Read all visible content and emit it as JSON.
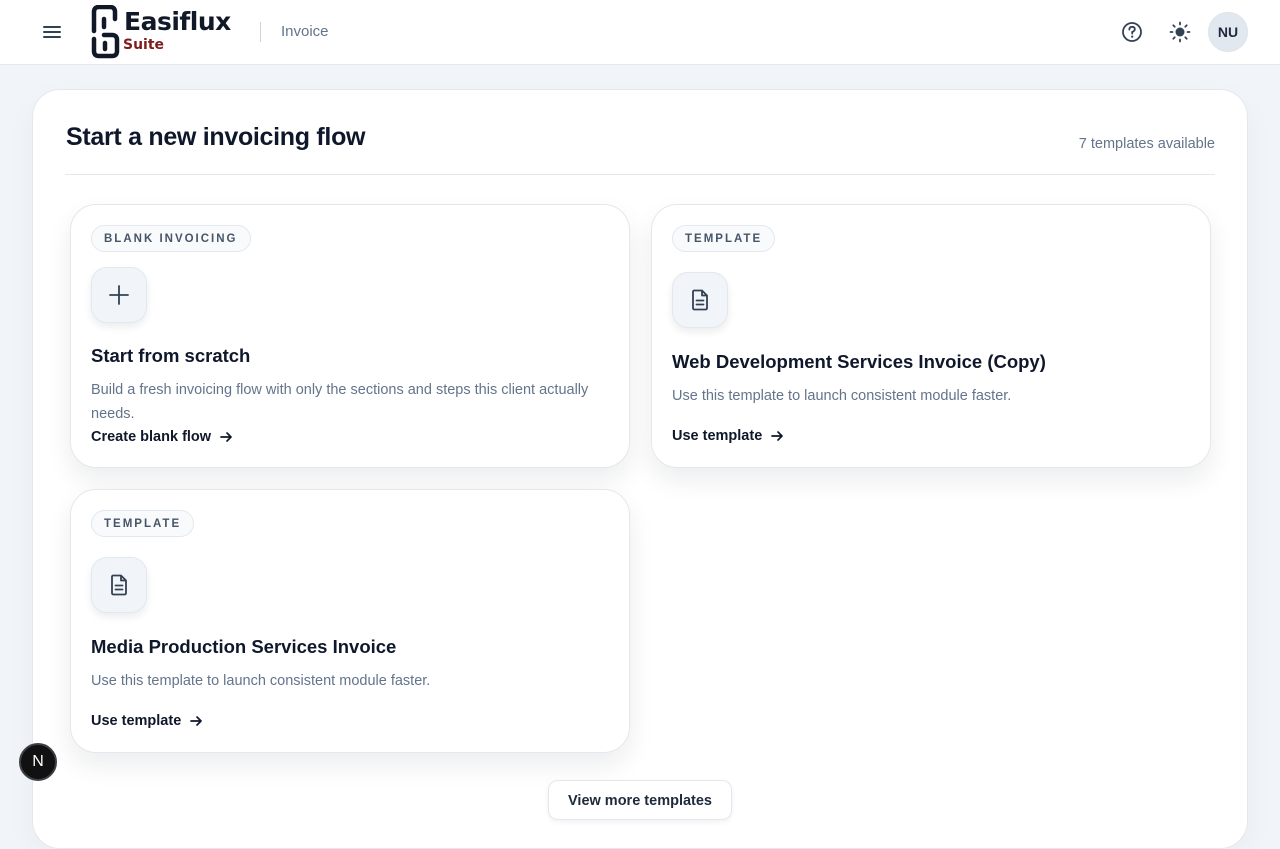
{
  "header": {
    "brand_name": "Easiflux",
    "brand_sub": "Suite",
    "breadcrumb": "Invoice",
    "avatar_initials": "NU",
    "icons": [
      "menu-icon",
      "help-icon",
      "sun-icon"
    ]
  },
  "main": {
    "title": "Start a new invoicing flow",
    "templates_count": "7 templates available",
    "cards": [
      {
        "badge": "BLANK INVOICING",
        "icon": "plus-icon",
        "title": "Start from scratch",
        "description": "Build a fresh invoicing flow with only the sections and steps this client actually needs.",
        "action": "Create blank flow"
      },
      {
        "badge": "TEMPLATE",
        "icon": "document-icon",
        "title": "Web Development Services Invoice (Copy)",
        "description": "Use this template to launch consistent module faster.",
        "action": "Use template"
      },
      {
        "badge": "TEMPLATE",
        "icon": "document-icon",
        "title": "Media Production Services Invoice",
        "description": "Use this template to launch consistent module faster.",
        "action": "Use template"
      }
    ],
    "more_button": "View more templates"
  },
  "dev_badge": "N",
  "colors": {
    "page_bg": "#f1f4f8",
    "text_primary": "#0f172a",
    "text_muted": "#64748b",
    "brand_accent": "#7f1d1d"
  }
}
